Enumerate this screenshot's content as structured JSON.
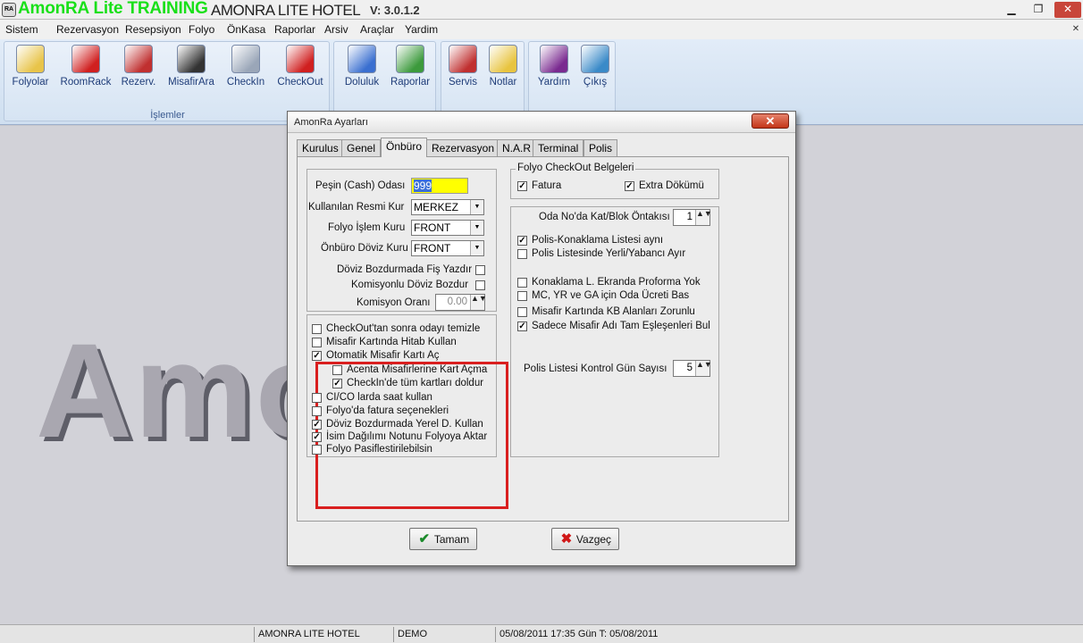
{
  "window": {
    "app_icon": "RA",
    "app_title": "AmonRA Lite TRAINING",
    "hotel_title": "AMONRA LITE HOTEL",
    "version": "V: 3.0.1.2",
    "minimize_label": "▁",
    "restore_label": "❐",
    "close_label": "✕",
    "mdi_close_label": "✕"
  },
  "menu": [
    "Sistem",
    "Rezervasyon",
    "Resepsiyon",
    "Folyo",
    "ÖnKasa",
    "Raporlar",
    "Arsiv",
    "Araçlar",
    "Yardim"
  ],
  "ribbon": {
    "group_label": "İşlemler",
    "buttons": [
      {
        "label": "Folyolar",
        "icon": "folders-icon",
        "color": "#e8c44a"
      },
      {
        "label": "RoomRack",
        "icon": "room-grid-icon",
        "color": "#d02020"
      },
      {
        "label": "Rezerv.",
        "icon": "telephone-icon",
        "color": "#c03030"
      },
      {
        "label": "MisafirAra",
        "icon": "binoculars-icon",
        "color": "#333333"
      },
      {
        "label": "CheckIn",
        "icon": "airplane-icon",
        "color": "#9aa6b8"
      },
      {
        "label": "CheckOut",
        "icon": "race-car-icon",
        "color": "#d02020"
      },
      {
        "label": "Doluluk",
        "icon": "chart-icon",
        "color": "#3a6fd0"
      },
      {
        "label": "Raporlar",
        "icon": "report-book-icon",
        "color": "#3c9a3c"
      },
      {
        "label": "Servis",
        "icon": "service-icon",
        "color": "#c03030"
      },
      {
        "label": "Notlar",
        "icon": "notes-icon",
        "color": "#e8c440"
      },
      {
        "label": "Yardım",
        "icon": "help-book-icon",
        "color": "#7a2a90"
      },
      {
        "label": "Çıkış",
        "icon": "exit-door-icon",
        "color": "#3a8ac8"
      }
    ]
  },
  "background_logo": "Amo",
  "status": [
    "AMONRA LITE HOTEL",
    "DEMO",
    "05/08/2011   17:35 Gün T: 05/08/2011"
  ],
  "dialog": {
    "title": "AmonRa Ayarları",
    "close_label": "✕",
    "tabs": [
      "Kurulus",
      "Genel",
      "Önbüro",
      "Rezervasyon",
      "N.A.R",
      "Terminal",
      "Polis"
    ],
    "active_tab": "Önbüro",
    "left": {
      "cash_room_label": "Peşin (Cash) Odası",
      "cash_room_value": "999",
      "official_rate_label": "Kullanılan Resmi Kur",
      "official_rate_value": "MERKEZ",
      "folio_rate_label": "Folyo İşlem Kuru",
      "folio_rate_value": "FRONT",
      "frontoffice_rate_label": "Önbüro Döviz Kuru",
      "frontoffice_rate_value": "FRONT",
      "print_receipt_label": "Döviz Bozdurmada Fiş Yazdır",
      "commission_exchange_label": "Komisyonlu Döviz Bozdur",
      "commission_rate_label": "Komisyon Oranı",
      "commission_rate_value": "0.00"
    },
    "checks": [
      {
        "label": "CheckOut'tan sonra odayı temizle",
        "checked": false
      },
      {
        "label": "Misafir Kartında Hitab Kullan",
        "checked": false
      },
      {
        "label": "Otomatik Misafir Kartı Aç",
        "checked": true
      },
      {
        "label": "Acenta Misafirlerine Kart Açma",
        "checked": false
      },
      {
        "label": "CheckIn'de tüm kartları doldur",
        "checked": true
      },
      {
        "label": "CI/CO larda saat kullan",
        "checked": false
      },
      {
        "label": "Folyo'da fatura seçenekleri",
        "checked": false
      },
      {
        "label": "Döviz Bozdurmada Yerel D. Kullan",
        "checked": true
      },
      {
        "label": "İsim Dağılımı Notunu Folyoya Aktar",
        "checked": true
      },
      {
        "label": "Folyo Pasiflestirilebilsin",
        "checked": false
      }
    ],
    "checkout_docs": {
      "title": "Folyo CheckOut Belgeleri",
      "invoice_label": "Fatura",
      "extra_label": "Extra Dökümü"
    },
    "right": {
      "floor_prefix_label": "Oda No'da Kat/Blok Öntakısı",
      "floor_prefix_value": "1",
      "police_same_label": "Polis-Konaklama Listesi aynı",
      "police_separate_label": "Polis Listesinde Yerli/Yabancı Ayır",
      "proforma_label": "Konaklama L. Ekranda Proforma Yok",
      "mc_label": "MC, YR ve GA için Oda Ücreti Bas",
      "kb_label": "Misafir Kartında KB Alanları Zorunlu",
      "exact_match_label": "Sadece Misafir Adı Tam Eşleşenleri Bul",
      "police_days_label": "Polis Listesi Kontrol Gün Sayısı",
      "police_days_value": "5"
    },
    "ok_label": "Tamam",
    "cancel_label": "Vazgeç",
    "spin_arrows": "▲▼",
    "dropdown_arrow": "▼",
    "check_mark": "✓",
    "ok_icon": "✔",
    "cancel_icon": "✖"
  }
}
